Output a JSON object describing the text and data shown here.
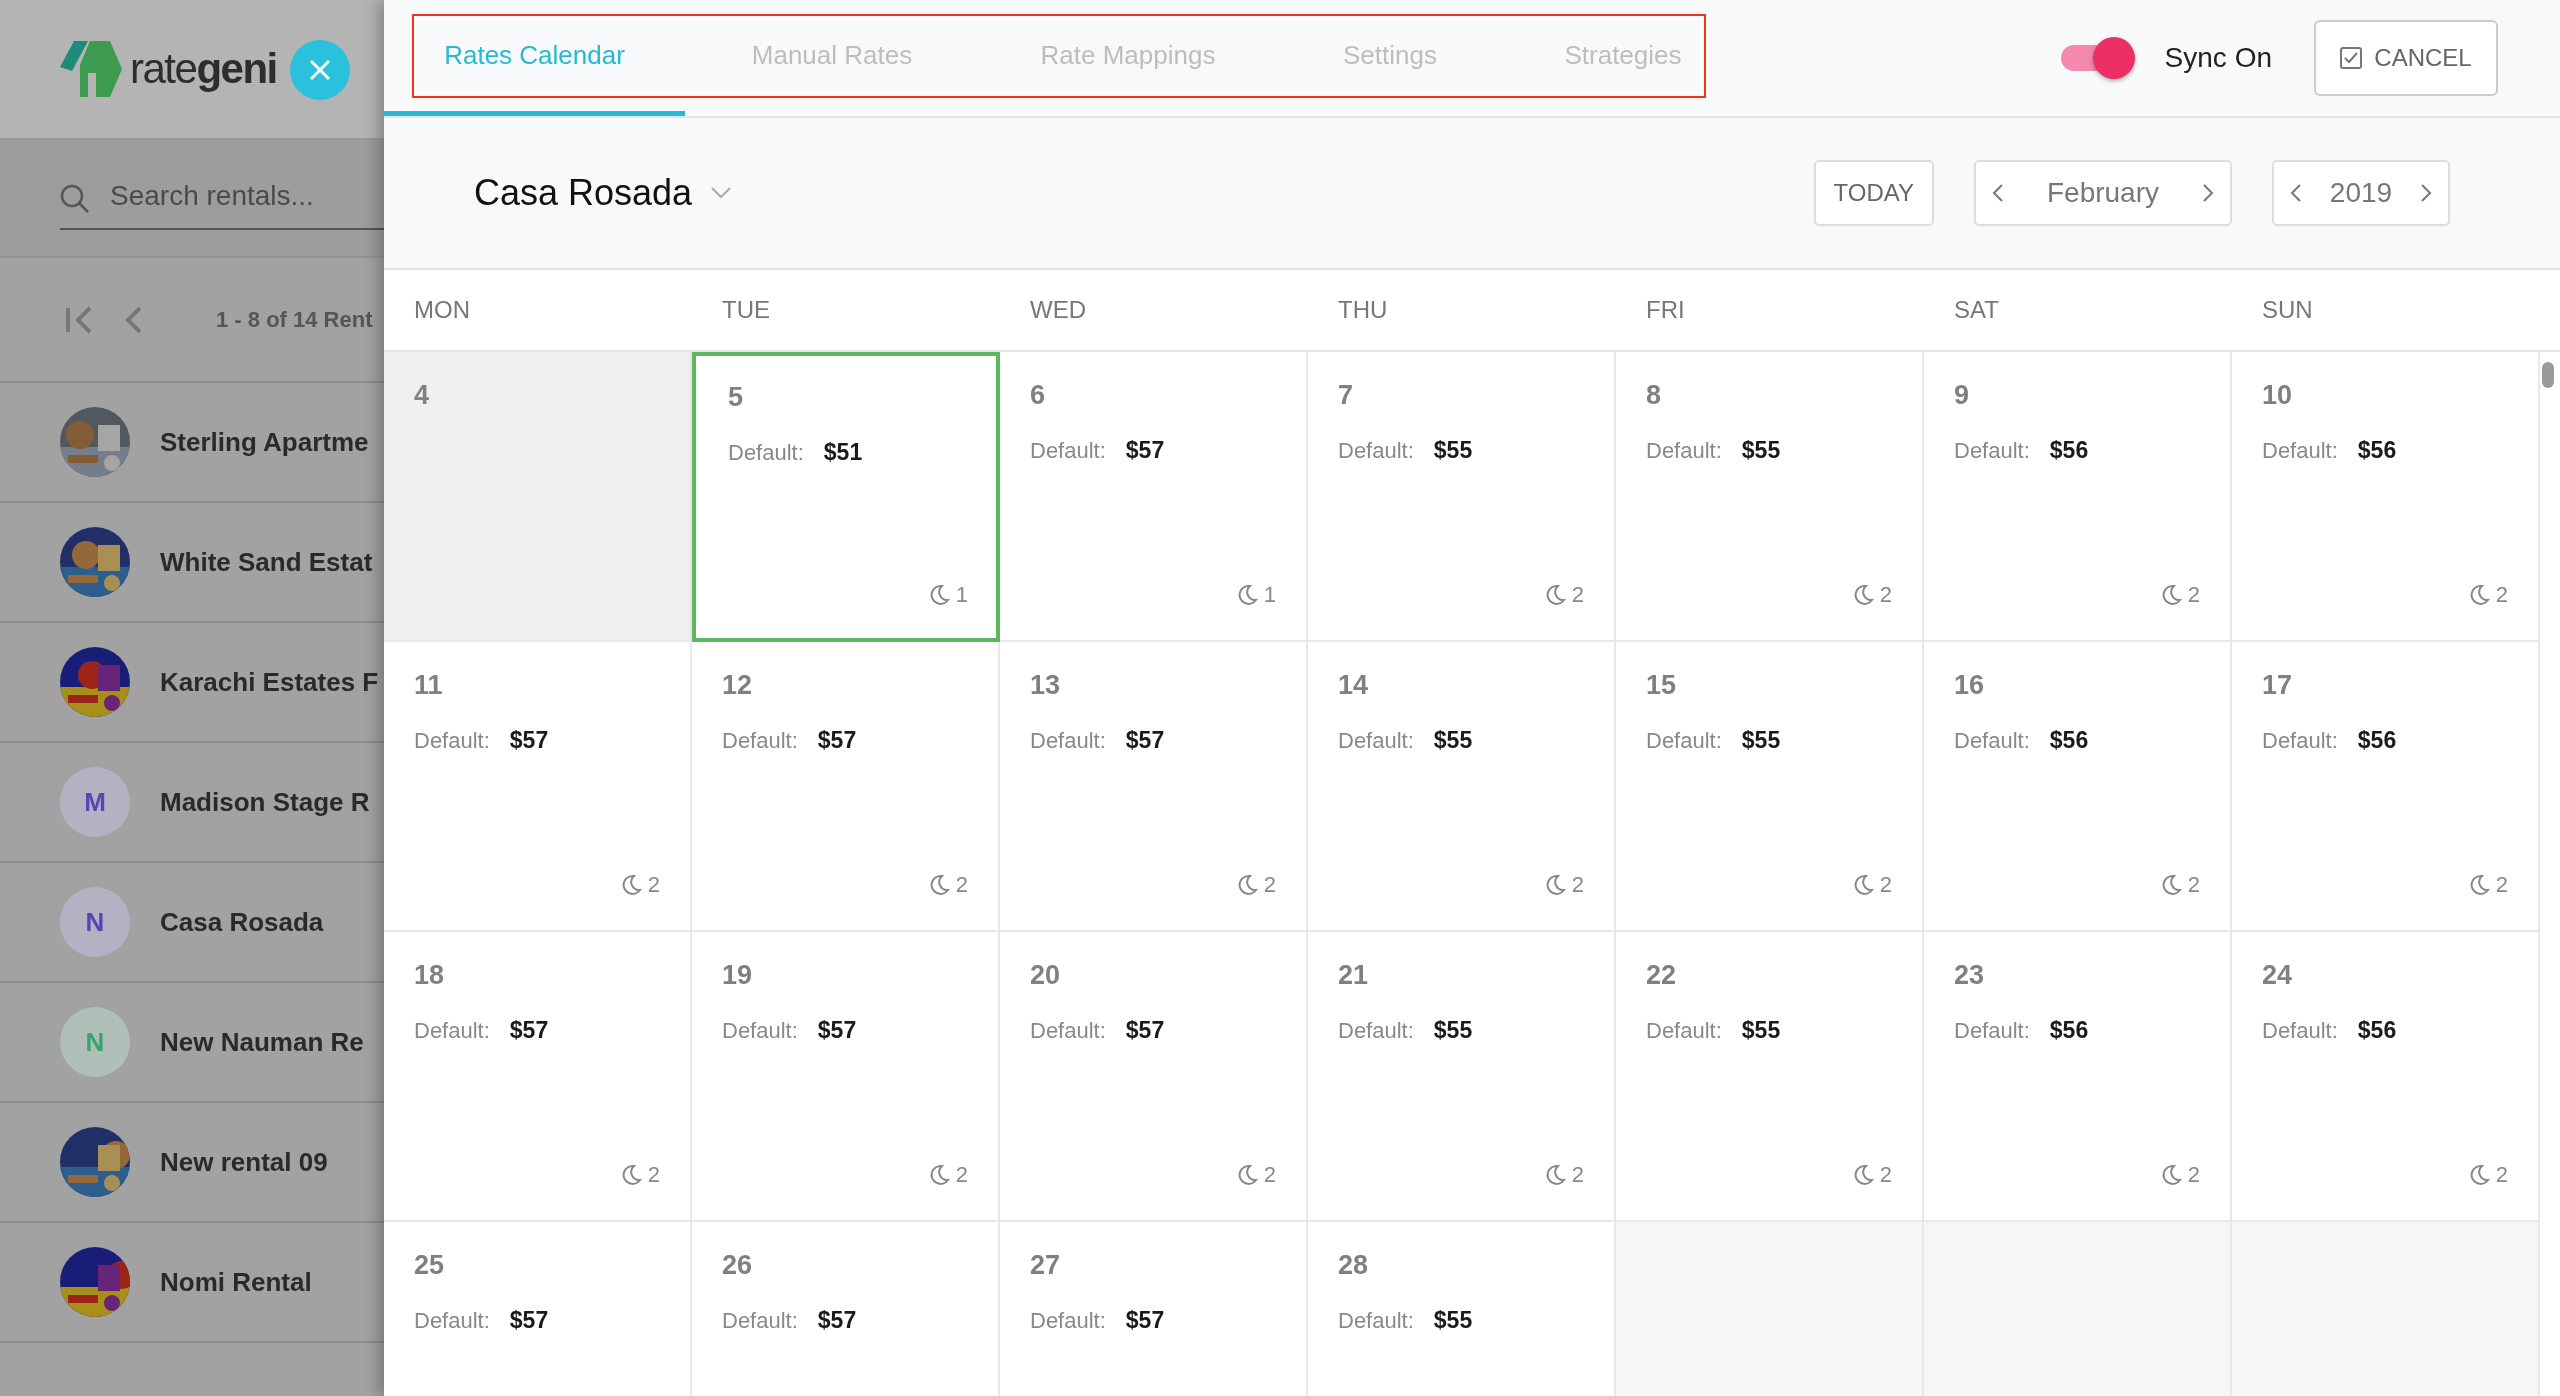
{
  "sidebar": {
    "logo": "rate**geni**",
    "search": {
      "placeholder": "Search rentals..."
    },
    "pagination": "1 - 8 of 14 Rent",
    "rentals": [
      {
        "name": "Sterling Apartme"
      },
      {
        "name": "White Sand Estat"
      },
      {
        "name": "Karachi Estates F"
      },
      {
        "name": "Madison Stage R",
        "avatar": {
          "kind": "letter",
          "letter": "M",
          "color": "#5546b8"
        }
      },
      {
        "name": "Casa Rosada",
        "avatar": {
          "kind": "letter",
          "letter": "N",
          "color": "#5546b8"
        }
      },
      {
        "name": "New Nauman Re",
        "avatar": {
          "kind": "letter",
          "letter": "N",
          "color": "#36a56e"
        }
      },
      {
        "name": "New rental 09"
      },
      {
        "name": "Nomi Rental"
      }
    ]
  },
  "tabs": [
    {
      "label": "Rates Calendar",
      "selected": true
    },
    {
      "label": "Manual Rates",
      "selected": false
    },
    {
      "label": "Rate Mappings",
      "selected": false
    },
    {
      "label": "Settings",
      "selected": false
    },
    {
      "label": "Strategies",
      "selected": false
    }
  ],
  "sync": {
    "label": "Sync On",
    "on": true
  },
  "cancel_button": "CANCEL",
  "rental_select": "Casa Rosada",
  "today_button": "TODAY",
  "month": "February",
  "year": "2019",
  "weekdays": [
    "MON",
    "TUE",
    "WED",
    "THU",
    "FRI",
    "SAT",
    "SUN"
  ],
  "weeks": [
    [
      {
        "kind": "past",
        "day": "4",
        "selected": false
      },
      {
        "kind": "day",
        "day": "5",
        "label": "Default:",
        "rate": "$51",
        "nights": "1",
        "selected": true
      },
      {
        "kind": "day",
        "day": "6",
        "label": "Default:",
        "rate": "$57",
        "nights": "1",
        "selected": false
      },
      {
        "kind": "day",
        "day": "7",
        "label": "Default:",
        "rate": "$55",
        "nights": "2",
        "selected": false
      },
      {
        "kind": "day",
        "day": "8",
        "label": "Default:",
        "rate": "$55",
        "nights": "2",
        "selected": false
      },
      {
        "kind": "day",
        "day": "9",
        "label": "Default:",
        "rate": "$56",
        "nights": "2",
        "selected": false
      },
      {
        "kind": "day",
        "day": "10",
        "label": "Default:",
        "rate": "$56",
        "nights": "2",
        "selected": false
      }
    ],
    [
      {
        "kind": "day",
        "day": "11",
        "label": "Default:",
        "rate": "$57",
        "nights": "2",
        "selected": false
      },
      {
        "kind": "day",
        "day": "12",
        "label": "Default:",
        "rate": "$57",
        "nights": "2",
        "selected": false
      },
      {
        "kind": "day",
        "day": "13",
        "label": "Default:",
        "rate": "$57",
        "nights": "2",
        "selected": false
      },
      {
        "kind": "day",
        "day": "14",
        "label": "Default:",
        "rate": "$55",
        "nights": "2",
        "selected": false
      },
      {
        "kind": "day",
        "day": "15",
        "label": "Default:",
        "rate": "$55",
        "nights": "2",
        "selected": false
      },
      {
        "kind": "day",
        "day": "16",
        "label": "Default:",
        "rate": "$56",
        "nights": "2",
        "selected": false
      },
      {
        "kind": "day",
        "day": "17",
        "label": "Default:",
        "rate": "$56",
        "nights": "2",
        "selected": false
      }
    ],
    [
      {
        "kind": "day",
        "day": "18",
        "label": "Default:",
        "rate": "$57",
        "nights": "2",
        "selected": false
      },
      {
        "kind": "day",
        "day": "19",
        "label": "Default:",
        "rate": "$57",
        "nights": "2",
        "selected": false
      },
      {
        "kind": "day",
        "day": "20",
        "label": "Default:",
        "rate": "$57",
        "nights": "2",
        "selected": false
      },
      {
        "kind": "day",
        "day": "21",
        "label": "Default:",
        "rate": "$55",
        "nights": "2",
        "selected": false
      },
      {
        "kind": "day",
        "day": "22",
        "label": "Default:",
        "rate": "$55",
        "nights": "2",
        "selected": false
      },
      {
        "kind": "day",
        "day": "23",
        "label": "Default:",
        "rate": "$56",
        "nights": "2",
        "selected": false
      },
      {
        "kind": "day",
        "day": "24",
        "label": "Default:",
        "rate": "$56",
        "nights": "2",
        "selected": false
      }
    ],
    [
      {
        "kind": "day",
        "day": "25",
        "label": "Default:",
        "rate": "$57",
        "selected": false
      },
      {
        "kind": "day",
        "day": "26",
        "label": "Default:",
        "rate": "$57",
        "selected": false
      },
      {
        "kind": "day",
        "day": "27",
        "label": "Default:",
        "rate": "$57",
        "selected": false
      },
      {
        "kind": "day",
        "day": "28",
        "label": "Default:",
        "rate": "$55",
        "selected": false
      },
      {
        "kind": "empty"
      },
      {
        "kind": "empty"
      },
      {
        "kind": "empty"
      }
    ]
  ]
}
